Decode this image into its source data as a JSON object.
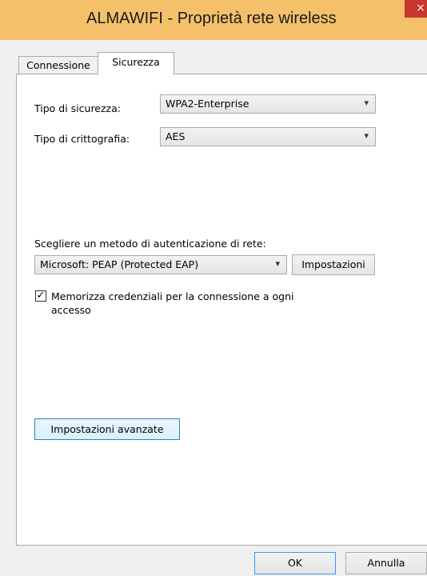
{
  "window": {
    "title": "ALMAWIFI - Proprietà rete wireless",
    "close_glyph": "×"
  },
  "tabs": [
    {
      "label": "Connessione",
      "selected": false
    },
    {
      "label": "Sicurezza",
      "selected": true
    }
  ],
  "security": {
    "type_label": "Tipo di sicurezza:",
    "type_value": "WPA2-Enterprise",
    "encryption_label": "Tipo di crittografia:",
    "encryption_value": "AES"
  },
  "auth": {
    "method_label": "Scegliere un metodo di autenticazione di rete:",
    "method_value": "Microsoft: PEAP (Protected EAP)",
    "settings_button": "Impostazioni",
    "remember_checked": true,
    "remember_label_line1": "Memorizza credenziali per la connessione a ogni",
    "remember_label_line2": "accesso"
  },
  "advanced_button": "Impostazioni avanzate",
  "footer": {
    "ok_label": "OK",
    "cancel_label": "Annulla"
  },
  "icons": {
    "dropdown": "chevron-down-icon",
    "check": "check-icon"
  },
  "colors": {
    "titlebar": "#f4c06a",
    "close": "#c7372f",
    "focus_border": "#3c7fb1"
  }
}
